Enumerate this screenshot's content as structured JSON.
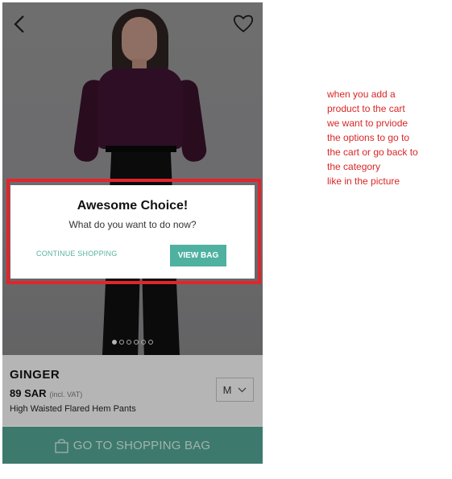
{
  "header": {
    "back_icon": "chevron-left-icon",
    "wishlist_icon": "heart-icon"
  },
  "carousel": {
    "dot_count": 6,
    "active_index": 0
  },
  "dialog": {
    "title": "Awesome Choice!",
    "subtitle": "What do you want to do now?",
    "continue_label": "CONTINUE SHOPPING",
    "view_bag_label": "VIEW BAG"
  },
  "product": {
    "brand": "GINGER",
    "price": "89 SAR",
    "vat_note": "(incl. VAT)",
    "name": "High Waisted Flared Hem Pants",
    "size": "M"
  },
  "cta": {
    "label": "GO TO SHOPPING BAG",
    "icon": "shopping-bag-icon"
  },
  "annotation": {
    "lines": [
      "when you add a",
      "product to the cart",
      "we want to prviode",
      "the options to go to",
      "the cart or go back to",
      "the category",
      "like in the picture"
    ]
  },
  "colors": {
    "accent": "#4fb1a0",
    "cta_bg": "#4f9d8c",
    "highlight": "#e3242b",
    "note_text": "#d92626"
  }
}
